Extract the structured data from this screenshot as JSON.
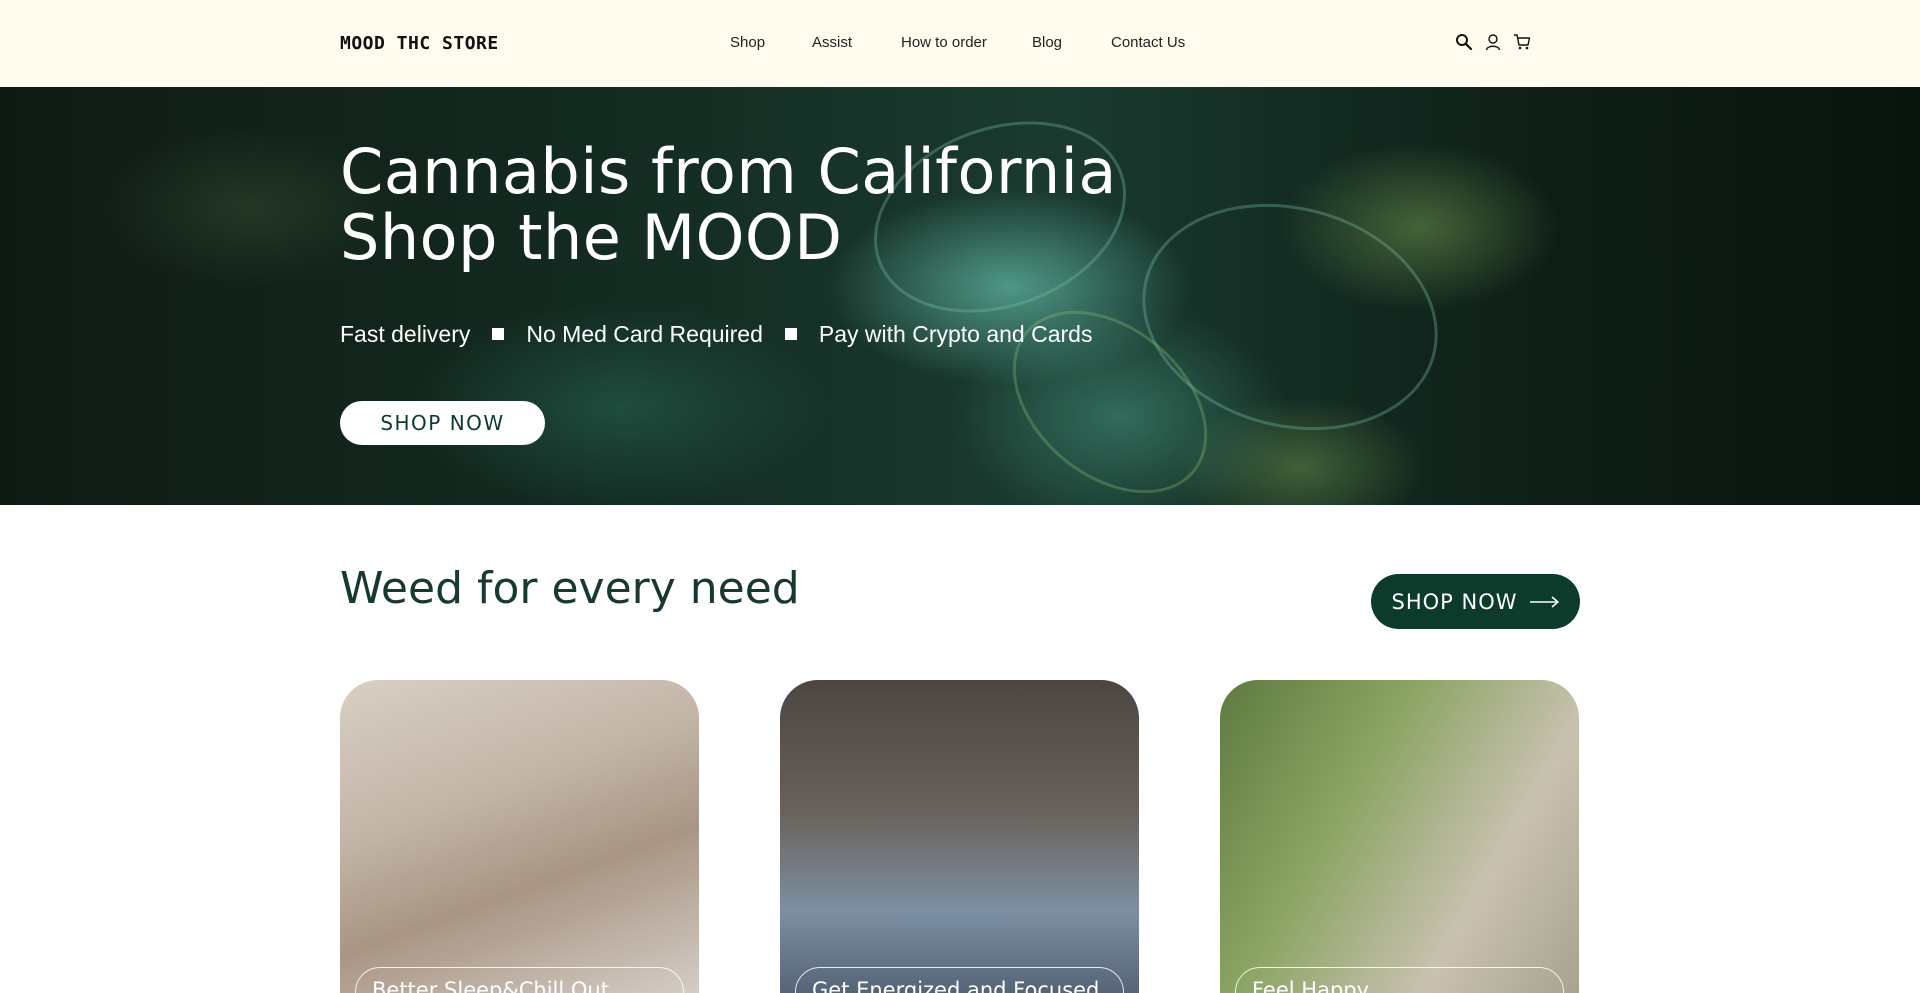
{
  "header": {
    "logo": "MOOD THC STORE",
    "nav": [
      "Shop",
      "Assist",
      "How to order",
      "Blog",
      "Contact Us"
    ],
    "icons": [
      "search-icon",
      "account-icon",
      "cart-icon"
    ]
  },
  "hero": {
    "title_line1": "Cannabis from California",
    "title_line2": "Shop the MOOD",
    "features": [
      "Fast delivery",
      "No Med Card Required",
      "Pay with Crypto and Cards"
    ],
    "button": "SHOP NOW"
  },
  "section": {
    "title": "Weed for every need",
    "button": "SHOP NOW",
    "cards": [
      {
        "label": "Better Sleep&Chill Out"
      },
      {
        "label": "Get Energized and Focused"
      },
      {
        "label": "Feel Happy"
      }
    ]
  },
  "colors": {
    "header_bg": "#fffbee",
    "accent_green": "#0d3b2b",
    "title_green": "#173a2c"
  }
}
